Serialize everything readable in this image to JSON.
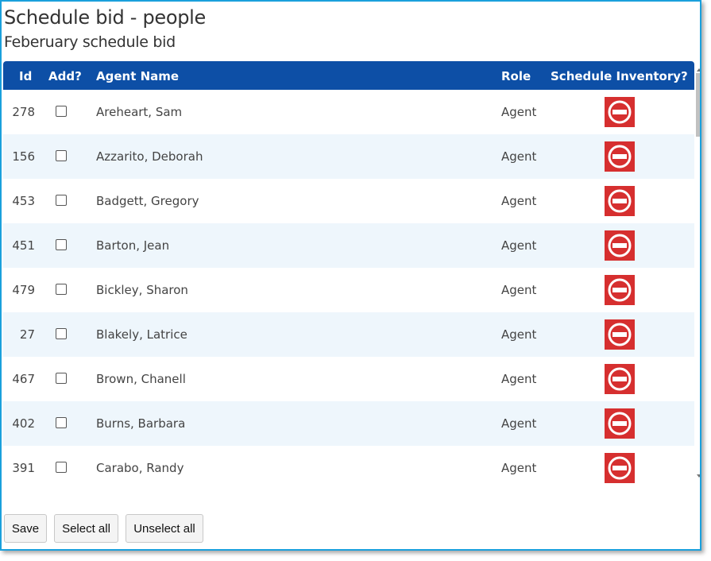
{
  "header": {
    "title": "Schedule bid - people",
    "subtitle": "Feberuary schedule bid"
  },
  "table": {
    "columns": {
      "id": "Id",
      "add": "Add?",
      "name": "Agent Name",
      "role": "Role",
      "inventory": "Schedule Inventory?"
    },
    "rows": [
      {
        "id": "278",
        "name": "Areheart, Sam",
        "role": "Agent",
        "checked": false,
        "inventory_icon": "no-entry-icon"
      },
      {
        "id": "156",
        "name": "Azzarito, Deborah",
        "role": "Agent",
        "checked": false,
        "inventory_icon": "no-entry-icon"
      },
      {
        "id": "453",
        "name": "Badgett, Gregory",
        "role": "Agent",
        "checked": false,
        "inventory_icon": "no-entry-icon"
      },
      {
        "id": "451",
        "name": "Barton, Jean",
        "role": "Agent",
        "checked": false,
        "inventory_icon": "no-entry-icon"
      },
      {
        "id": "479",
        "name": "Bickley, Sharon",
        "role": "Agent",
        "checked": false,
        "inventory_icon": "no-entry-icon"
      },
      {
        "id": "27",
        "name": "Blakely, Latrice",
        "role": "Agent",
        "checked": false,
        "inventory_icon": "no-entry-icon"
      },
      {
        "id": "467",
        "name": "Brown, Chanell",
        "role": "Agent",
        "checked": false,
        "inventory_icon": "no-entry-icon"
      },
      {
        "id": "402",
        "name": "Burns, Barbara",
        "role": "Agent",
        "checked": false,
        "inventory_icon": "no-entry-icon"
      },
      {
        "id": "391",
        "name": "Carabo, Randy",
        "role": "Agent",
        "checked": false,
        "inventory_icon": "no-entry-icon"
      }
    ]
  },
  "buttons": {
    "save": "Save",
    "select_all": "Select all",
    "unselect_all": "Unselect all"
  },
  "colors": {
    "header_bg": "#0d4fa6",
    "row_alt_bg": "#eef6fc",
    "icon_bg": "#d62f2f",
    "frame_border": "#1aa0dc"
  }
}
